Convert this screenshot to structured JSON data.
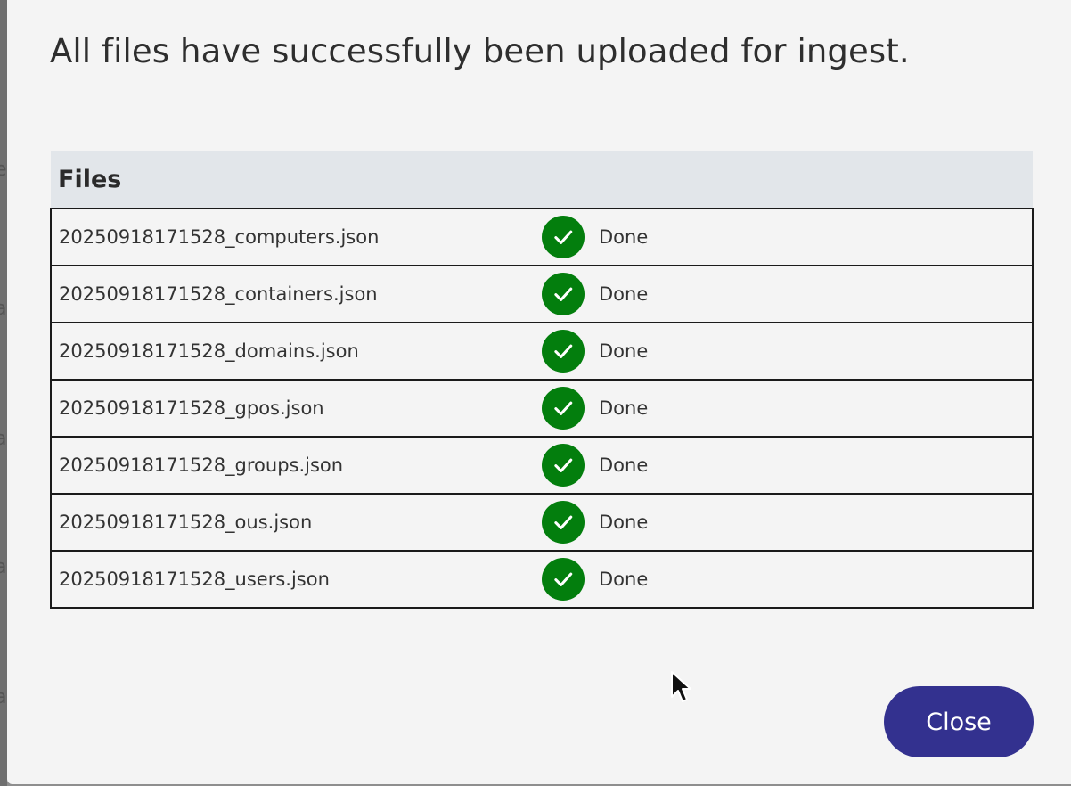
{
  "dialog": {
    "title": "All files have successfully been uploaded for ingest."
  },
  "table": {
    "header": "Files",
    "rows": [
      {
        "file": "20250918171528_computers.json",
        "status": "Done"
      },
      {
        "file": "20250918171528_containers.json",
        "status": "Done"
      },
      {
        "file": "20250918171528_domains.json",
        "status": "Done"
      },
      {
        "file": "20250918171528_gpos.json",
        "status": "Done"
      },
      {
        "file": "20250918171528_groups.json",
        "status": "Done"
      },
      {
        "file": "20250918171528_ous.json",
        "status": "Done"
      },
      {
        "file": "20250918171528_users.json",
        "status": "Done"
      }
    ]
  },
  "actions": {
    "close_label": "Close"
  },
  "icons": {
    "status_icon": "check-circle-icon",
    "status_color": "#037e0d",
    "button_color": "#33318f"
  }
}
